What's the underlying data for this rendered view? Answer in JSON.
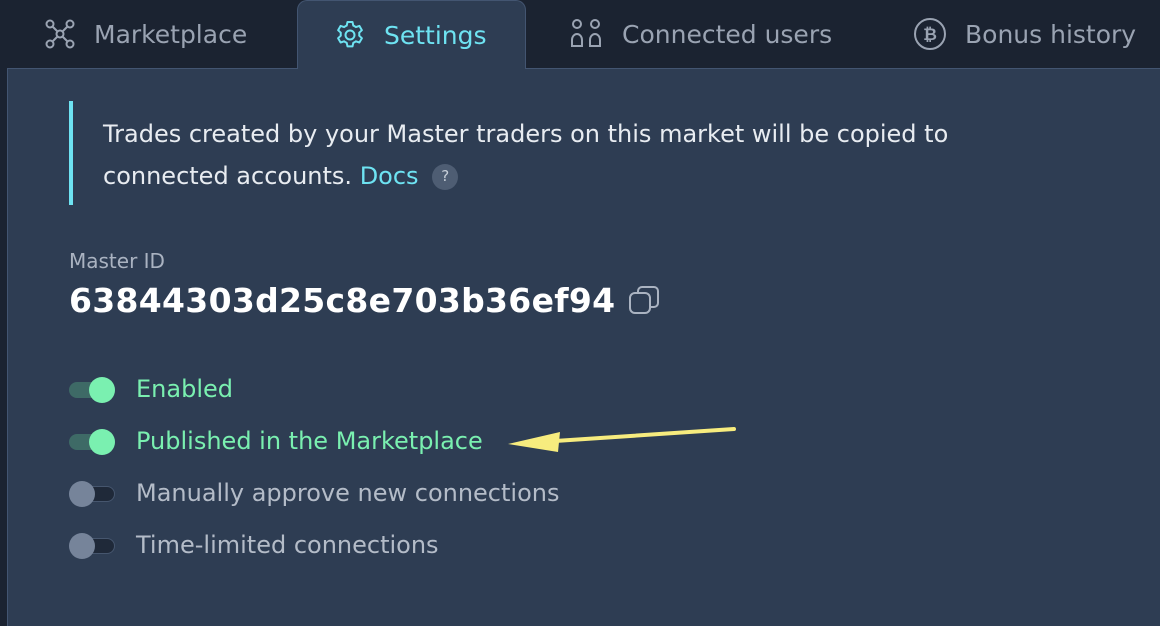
{
  "tabs": [
    {
      "label": "Marketplace",
      "icon": "network-icon",
      "active": false
    },
    {
      "label": "Settings",
      "icon": "gear-icon",
      "active": true
    },
    {
      "label": "Connected users",
      "icon": "users-icon",
      "active": false
    },
    {
      "label": "Bonus history",
      "icon": "bitcoin-icon",
      "active": false
    }
  ],
  "notice": {
    "text": "Trades created by your Master traders on this market will be copied to connected accounts.",
    "link_label": "Docs",
    "help_label": "?"
  },
  "master": {
    "label": "Master ID",
    "id": "63844303d25c8e703b36ef94"
  },
  "toggles": [
    {
      "label": "Enabled",
      "on": true
    },
    {
      "label": "Published in the Marketplace",
      "on": true
    },
    {
      "label": "Manually approve new connections",
      "on": false
    },
    {
      "label": "Time-limited connections",
      "on": false
    }
  ],
  "colors": {
    "accent": "#6ee3f2",
    "toggle_on": "#7af0b0",
    "panel_bg": "#2e3d53",
    "page_bg": "#1b2331",
    "annotation_arrow": "#f7ec7e"
  }
}
